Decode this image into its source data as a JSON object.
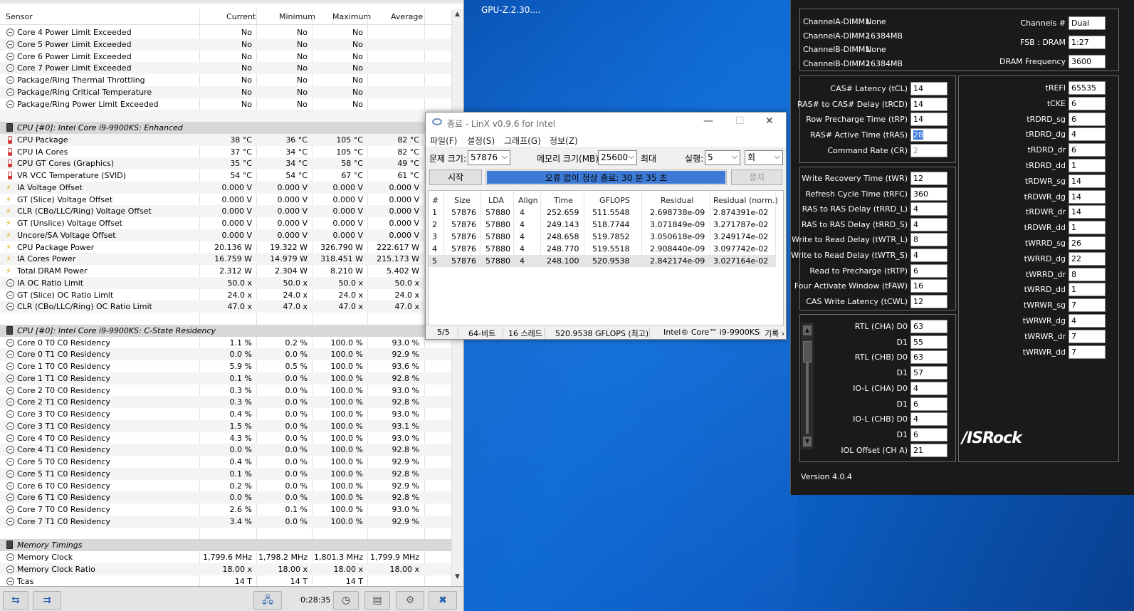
{
  "hwinfo": {
    "columns": [
      "Sensor",
      "Current",
      "Minimum",
      "Maximum",
      "Average"
    ],
    "rows": [
      {
        "icon": "circle",
        "name": "Core 4 Power Limit Exceeded",
        "cur": "No",
        "min": "No",
        "max": "No",
        "avg": ""
      },
      {
        "icon": "circle",
        "name": "Core 5 Power Limit Exceeded",
        "cur": "No",
        "min": "No",
        "max": "No",
        "avg": ""
      },
      {
        "icon": "circle",
        "name": "Core 6 Power Limit Exceeded",
        "cur": "No",
        "min": "No",
        "max": "No",
        "avg": ""
      },
      {
        "icon": "circle",
        "name": "Core 7 Power Limit Exceeded",
        "cur": "No",
        "min": "No",
        "max": "No",
        "avg": ""
      },
      {
        "icon": "circle",
        "name": "Package/Ring Thermal Throttling",
        "cur": "No",
        "min": "No",
        "max": "No",
        "avg": ""
      },
      {
        "icon": "circle",
        "name": "Package/Ring Critical Temperature",
        "cur": "No",
        "min": "No",
        "max": "No",
        "avg": ""
      },
      {
        "icon": "circle",
        "name": "Package/Ring Power Limit Exceeded",
        "cur": "No",
        "min": "No",
        "max": "No",
        "avg": ""
      },
      {
        "icon": "blank",
        "name": "",
        "cur": "",
        "min": "",
        "max": "",
        "avg": ""
      },
      {
        "icon": "chip",
        "group": true,
        "name": "CPU [#0]: Intel Core i9-9900KS: Enhanced",
        "cur": "",
        "min": "",
        "max": "",
        "avg": ""
      },
      {
        "icon": "temp",
        "name": "CPU Package",
        "cur": "38 °C",
        "min": "36 °C",
        "max": "105 °C",
        "avg": "82 °C"
      },
      {
        "icon": "temp",
        "name": "CPU IA Cores",
        "cur": "37 °C",
        "min": "34 °C",
        "max": "105 °C",
        "avg": "82 °C"
      },
      {
        "icon": "temp",
        "name": "CPU GT Cores (Graphics)",
        "cur": "35 °C",
        "min": "34 °C",
        "max": "58 °C",
        "avg": "49 °C"
      },
      {
        "icon": "temp",
        "name": "VR VCC Temperature (SVID)",
        "cur": "54 °C",
        "min": "54 °C",
        "max": "67 °C",
        "avg": "61 °C"
      },
      {
        "icon": "volt",
        "name": "IA Voltage Offset",
        "cur": "0.000 V",
        "min": "0.000 V",
        "max": "0.000 V",
        "avg": "0.000 V"
      },
      {
        "icon": "volt",
        "name": "GT (Slice) Voltage Offset",
        "cur": "0.000 V",
        "min": "0.000 V",
        "max": "0.000 V",
        "avg": "0.000 V"
      },
      {
        "icon": "volt",
        "name": "CLR (CBo/LLC/Ring) Voltage Offset",
        "cur": "0.000 V",
        "min": "0.000 V",
        "max": "0.000 V",
        "avg": "0.000 V"
      },
      {
        "icon": "volt",
        "name": "GT (Unslice) Voltage Offset",
        "cur": "0.000 V",
        "min": "0.000 V",
        "max": "0.000 V",
        "avg": "0.000 V"
      },
      {
        "icon": "volt",
        "name": "Uncore/SA Voltage Offset",
        "cur": "0.000 V",
        "min": "0.000 V",
        "max": "0.000 V",
        "avg": "0.000 V"
      },
      {
        "icon": "volt",
        "name": "CPU Package Power",
        "cur": "20.136 W",
        "min": "19.322 W",
        "max": "326.790 W",
        "avg": "222.617 W"
      },
      {
        "icon": "volt",
        "name": "IA Cores Power",
        "cur": "16.759 W",
        "min": "14.979 W",
        "max": "318.451 W",
        "avg": "215.173 W"
      },
      {
        "icon": "volt",
        "name": "Total DRAM Power",
        "cur": "2.312 W",
        "min": "2.304 W",
        "max": "8.210 W",
        "avg": "5.402 W"
      },
      {
        "icon": "circle",
        "name": "IA OC Ratio Limit",
        "cur": "50.0 x",
        "min": "50.0 x",
        "max": "50.0 x",
        "avg": "50.0 x"
      },
      {
        "icon": "circle",
        "name": "GT (Slice) OC Ratio Limit",
        "cur": "24.0 x",
        "min": "24.0 x",
        "max": "24.0 x",
        "avg": "24.0 x"
      },
      {
        "icon": "circle",
        "name": "CLR (CBo/LLC/Ring) OC Ratio Limit",
        "cur": "47.0 x",
        "min": "47.0 x",
        "max": "47.0 x",
        "avg": "47.0 x"
      },
      {
        "icon": "blank",
        "name": "",
        "cur": "",
        "min": "",
        "max": "",
        "avg": ""
      },
      {
        "icon": "chip",
        "group": true,
        "name": "CPU [#0]: Intel Core i9-9900KS: C-State Residency",
        "cur": "",
        "min": "",
        "max": "",
        "avg": ""
      },
      {
        "icon": "circle",
        "name": "Core 0 T0 C0 Residency",
        "cur": "1.1 %",
        "min": "0.2 %",
        "max": "100.0 %",
        "avg": "93.0 %"
      },
      {
        "icon": "circle",
        "name": "Core 0 T1 C0 Residency",
        "cur": "0.0 %",
        "min": "0.0 %",
        "max": "100.0 %",
        "avg": "92.9 %"
      },
      {
        "icon": "circle",
        "name": "Core 1 T0 C0 Residency",
        "cur": "5.9 %",
        "min": "0.5 %",
        "max": "100.0 %",
        "avg": "93.6 %"
      },
      {
        "icon": "circle",
        "name": "Core 1 T1 C0 Residency",
        "cur": "0.1 %",
        "min": "0.0 %",
        "max": "100.0 %",
        "avg": "92.8 %"
      },
      {
        "icon": "circle",
        "name": "Core 2 T0 C0 Residency",
        "cur": "0.3 %",
        "min": "0.0 %",
        "max": "100.0 %",
        "avg": "93.0 %"
      },
      {
        "icon": "circle",
        "name": "Core 2 T1 C0 Residency",
        "cur": "0.3 %",
        "min": "0.0 %",
        "max": "100.0 %",
        "avg": "92.8 %"
      },
      {
        "icon": "circle",
        "name": "Core 3 T0 C0 Residency",
        "cur": "0.4 %",
        "min": "0.0 %",
        "max": "100.0 %",
        "avg": "93.0 %"
      },
      {
        "icon": "circle",
        "name": "Core 3 T1 C0 Residency",
        "cur": "1.5 %",
        "min": "0.0 %",
        "max": "100.0 %",
        "avg": "93.1 %"
      },
      {
        "icon": "circle",
        "name": "Core 4 T0 C0 Residency",
        "cur": "4.3 %",
        "min": "0.0 %",
        "max": "100.0 %",
        "avg": "93.0 %"
      },
      {
        "icon": "circle",
        "name": "Core 4 T1 C0 Residency",
        "cur": "0.0 %",
        "min": "0.0 %",
        "max": "100.0 %",
        "avg": "92.8 %"
      },
      {
        "icon": "circle",
        "name": "Core 5 T0 C0 Residency",
        "cur": "0.4 %",
        "min": "0.0 %",
        "max": "100.0 %",
        "avg": "92.9 %"
      },
      {
        "icon": "circle",
        "name": "Core 5 T1 C0 Residency",
        "cur": "0.1 %",
        "min": "0.0 %",
        "max": "100.0 %",
        "avg": "92.8 %"
      },
      {
        "icon": "circle",
        "name": "Core 6 T0 C0 Residency",
        "cur": "0.2 %",
        "min": "0.0 %",
        "max": "100.0 %",
        "avg": "92.9 %"
      },
      {
        "icon": "circle",
        "name": "Core 6 T1 C0 Residency",
        "cur": "0.0 %",
        "min": "0.0 %",
        "max": "100.0 %",
        "avg": "92.8 %"
      },
      {
        "icon": "circle",
        "name": "Core 7 T0 C0 Residency",
        "cur": "2.6 %",
        "min": "0.1 %",
        "max": "100.0 %",
        "avg": "93.0 %"
      },
      {
        "icon": "circle",
        "name": "Core 7 T1 C0 Residency",
        "cur": "3.4 %",
        "min": "0.0 %",
        "max": "100.0 %",
        "avg": "92.9 %"
      },
      {
        "icon": "blank",
        "name": "",
        "cur": "",
        "min": "",
        "max": "",
        "avg": ""
      },
      {
        "icon": "chip",
        "group": true,
        "name": "Memory Timings",
        "cur": "",
        "min": "",
        "max": "",
        "avg": ""
      },
      {
        "icon": "circle",
        "name": "Memory Clock",
        "cur": "1,799.6 MHz",
        "min": "1,798.2 MHz",
        "max": "1,801.3 MHz",
        "avg": "1,799.9 MHz"
      },
      {
        "icon": "circle",
        "name": "Memory Clock Ratio",
        "cur": "18.00 x",
        "min": "18.00 x",
        "max": "18.00 x",
        "avg": "18.00 x"
      },
      {
        "icon": "circle",
        "name": "Tcas",
        "cur": "14 T",
        "min": "14 T",
        "max": "14 T",
        "avg": ""
      }
    ],
    "timer": "0:28:35"
  },
  "gpuz_label": "GPU-Z.2.30....",
  "linx": {
    "title": "종료 - LinX v0.9.6 for Intel",
    "menu": [
      "파일(F)",
      "설정(S)",
      "그래프(G)",
      "정보(Z)"
    ],
    "problem_size_label": "문제 크기:",
    "problem_size": "57876",
    "memory_label": "메모리 크기(MB):",
    "memory": "25600",
    "max_label": "최대",
    "runs_label": "실행:",
    "runs": "5",
    "runs_unit": "회",
    "start_button": "시작",
    "stop_button": "정지",
    "progress_text": "오류 없이 정상 종료: 30 분 35 초",
    "progress": 1.0,
    "columns": [
      "#",
      "Size",
      "LDA",
      "Align",
      "Time",
      "GFLOPS",
      "Residual",
      "Residual (norm.)"
    ],
    "results": [
      [
        "1",
        "57876",
        "57880",
        "4",
        "252.659",
        "511.5548",
        "2.698738e-09",
        "2.874391e-02"
      ],
      [
        "2",
        "57876",
        "57880",
        "4",
        "249.143",
        "518.7744",
        "3.071849e-09",
        "3.271787e-02"
      ],
      [
        "3",
        "57876",
        "57880",
        "4",
        "248.658",
        "519.7852",
        "3.050618e-09",
        "3.249174e-02"
      ],
      [
        "4",
        "57876",
        "57880",
        "4",
        "248.770",
        "519.5518",
        "2.908440e-09",
        "3.097742e-02"
      ],
      [
        "5",
        "57876",
        "57880",
        "4",
        "248.100",
        "520.9538",
        "2.842174e-09",
        "3.027164e-02"
      ]
    ],
    "status": [
      "5/5",
      "64-비트",
      "16 스레드",
      "520.9538 GFLOPS (최고)",
      "Intel® Core™ i9-9900KS",
      "기록 ›"
    ]
  },
  "asrock": {
    "dimms": [
      [
        "ChannelA-DIMM1",
        "None"
      ],
      [
        "ChannelA-DIMM2",
        "16384MB"
      ],
      [
        "ChannelB-DIMM1",
        "None"
      ],
      [
        "ChannelB-DIMM2",
        "16384MB"
      ]
    ],
    "channels_label": "Channels #",
    "channels": "Dual",
    "fsb_label": "FSB : DRAM",
    "fsb": "1:27",
    "freq_label": "DRAM Frequency",
    "freq": "3600",
    "primary": [
      [
        "CAS# Latency (tCL)",
        "14"
      ],
      [
        "RAS# to CAS# Delay (tRCD)",
        "14"
      ],
      [
        "Row Precharge Time (tRP)",
        "14"
      ],
      [
        "RAS# Active Time (tRAS)",
        "28"
      ],
      [
        "Command Rate (CR)",
        "2"
      ]
    ],
    "secondary": [
      [
        "Write Recovery Time (tWR)",
        "12"
      ],
      [
        "Refresh Cycle Time (tRFC)",
        "360"
      ],
      [
        "RAS to RAS Delay (tRRD_L)",
        "4"
      ],
      [
        "RAS to RAS Delay (tRRD_S)",
        "4"
      ],
      [
        "Write to Read Delay (tWTR_L)",
        "8"
      ],
      [
        "Write to Read Delay (tWTR_S)",
        "4"
      ],
      [
        "Read to Precharge (tRTP)",
        "6"
      ],
      [
        "Four Activate Window (tFAW)",
        "16"
      ],
      [
        "CAS Write Latency (tCWL)",
        "12"
      ]
    ],
    "rtl": [
      [
        "RTL (CHA) D0",
        "63"
      ],
      [
        "D1",
        "55"
      ],
      [
        "RTL (CHB) D0",
        "63"
      ],
      [
        "D1",
        "57"
      ],
      [
        "IO-L (CHA) D0",
        "4"
      ],
      [
        "D1",
        "6"
      ],
      [
        "IO-L (CHB) D0",
        "4"
      ],
      [
        "D1",
        "6"
      ],
      [
        "IOL Offset (CH A)",
        "21"
      ]
    ],
    "right": [
      [
        "tREFI",
        "65535"
      ],
      [
        "tCKE",
        "6"
      ],
      [
        "tRDRD_sg",
        "6"
      ],
      [
        "tRDRD_dg",
        "4"
      ],
      [
        "tRDRD_dr",
        "6"
      ],
      [
        "tRDRD_dd",
        "1"
      ],
      [
        "tRDWR_sg",
        "14"
      ],
      [
        "tRDWR_dg",
        "14"
      ],
      [
        "tRDWR_dr",
        "14"
      ],
      [
        "tRDWR_dd",
        "1"
      ],
      [
        "tWRRD_sg",
        "26"
      ],
      [
        "tWRRD_dg",
        "22"
      ],
      [
        "tWRRD_dr",
        "8"
      ],
      [
        "tWRRD_dd",
        "1"
      ],
      [
        "tWRWR_sg",
        "7"
      ],
      [
        "tWRWR_dg",
        "4"
      ],
      [
        "tWRWR_dr",
        "7"
      ],
      [
        "tWRWR_dd",
        "7"
      ]
    ],
    "logo": "/ISRock",
    "version": "Version 4.0.4"
  }
}
